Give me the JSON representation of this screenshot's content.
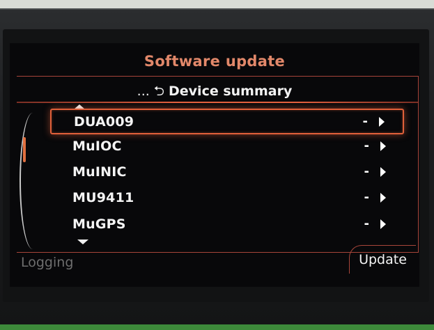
{
  "screen": {
    "title": "Software update",
    "breadcrumb": {
      "prefix": "...",
      "label": "Device summary"
    },
    "devices": [
      {
        "label": "DUA009",
        "value": "-",
        "selected": true
      },
      {
        "label": "MuIOC",
        "value": "-"
      },
      {
        "label": "MuINIC",
        "value": "-"
      },
      {
        "label": "MU9411",
        "value": "-"
      },
      {
        "label": "MuGPS",
        "value": "-"
      }
    ],
    "footer": {
      "logging_label": "Logging",
      "update_label": "Update"
    }
  },
  "colors": {
    "accent": "#e0603a",
    "title": "#e2886a",
    "text": "#f4f4f4",
    "disabled": "#6e6e6e",
    "background": "#08080a"
  },
  "icons": {
    "back": "return-arrow-icon",
    "row_arrow": "play-right-icon",
    "scroll_up": "triangle-up-icon",
    "scroll_down": "triangle-down-icon"
  }
}
